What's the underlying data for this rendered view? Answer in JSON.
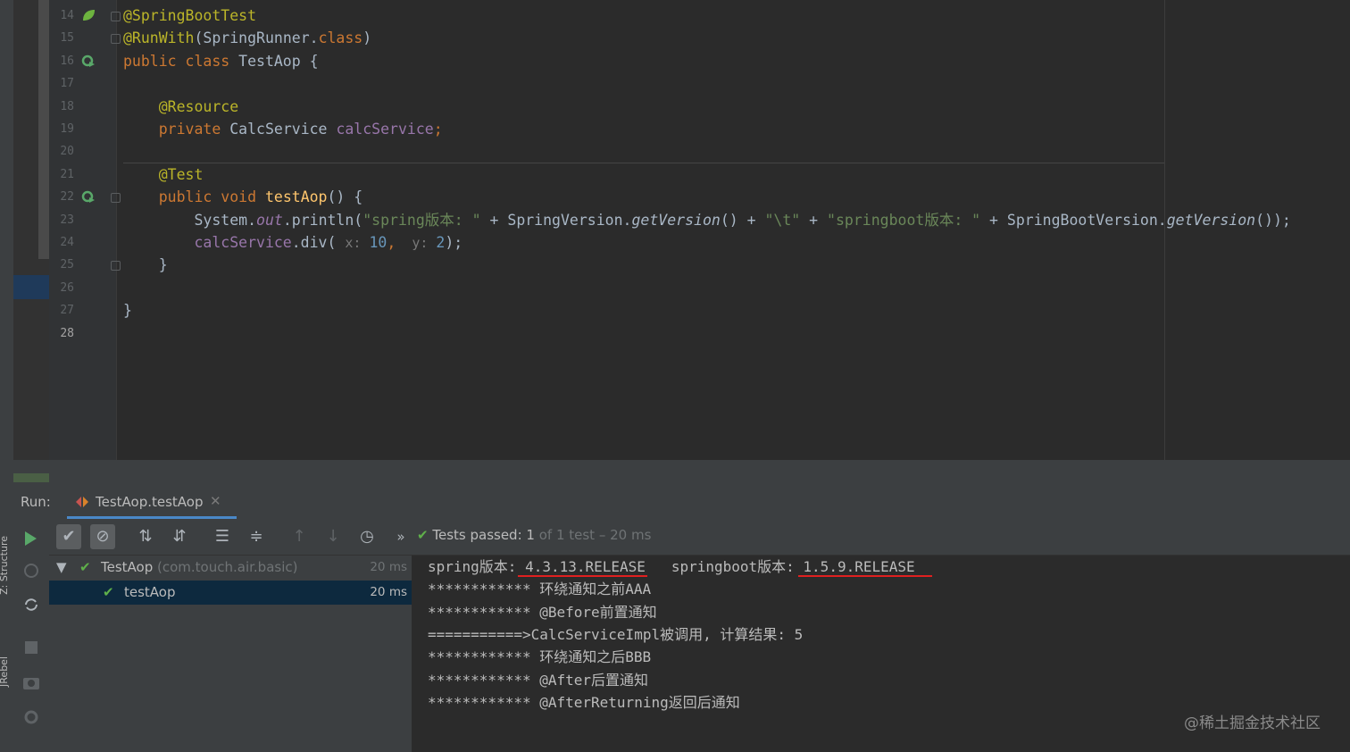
{
  "left_strip": {
    "tab_structure": "Z: Structure",
    "tab_rebel": "JRebel"
  },
  "editor": {
    "lines": [
      {
        "no": "14",
        "parts": [
          [
            "an",
            "@SpringBootTest"
          ]
        ]
      },
      {
        "no": "15",
        "parts": [
          [
            "an",
            "@RunWith"
          ],
          [
            "par",
            "(SpringRunner."
          ],
          [
            "kw",
            "class"
          ],
          [
            "par",
            ")"
          ]
        ]
      },
      {
        "no": "16",
        "parts": [
          [
            "kw",
            "public class "
          ],
          [
            "par",
            "TestAop {"
          ]
        ]
      },
      {
        "no": "17",
        "parts": []
      },
      {
        "no": "18",
        "parts": [
          [
            "an",
            "    @Resource"
          ]
        ]
      },
      {
        "no": "19",
        "parts": [
          [
            "kw",
            "    private "
          ],
          [
            "par",
            "CalcService "
          ],
          [
            "fld",
            "calcService"
          ],
          [
            "kw",
            ";"
          ]
        ]
      },
      {
        "no": "20",
        "parts": []
      },
      {
        "no": "21",
        "parts": [
          [
            "an",
            "    @Test"
          ]
        ]
      },
      {
        "no": "22",
        "parts": [
          [
            "kw",
            "    public void "
          ],
          [
            "fnc",
            "testAop"
          ],
          [
            "par",
            "() {"
          ]
        ]
      },
      {
        "no": "23",
        "parts": [
          [
            "par",
            "        System."
          ],
          [
            "fld it",
            "out"
          ],
          [
            "par",
            ".println("
          ],
          [
            "st",
            "\"spring版本: \""
          ],
          [
            "par",
            " + SpringVersion."
          ],
          [
            "it",
            "getVersion"
          ],
          [
            "par",
            "() + "
          ],
          [
            "st",
            "\"\\t\""
          ],
          [
            "par",
            " + "
          ],
          [
            "st",
            "\"springboot版本: \""
          ],
          [
            "par",
            " + SpringBootVersion."
          ],
          [
            "it",
            "getVersion"
          ],
          [
            "par",
            "());"
          ]
        ]
      },
      {
        "no": "24",
        "parts": [
          [
            "fld",
            "        calcService"
          ],
          [
            "par",
            ".div( "
          ],
          [
            "hint",
            "x: "
          ],
          [
            "num",
            "10"
          ],
          [
            "kw",
            ","
          ],
          [
            "hint",
            "  y: "
          ],
          [
            "num",
            "2"
          ],
          [
            "par",
            ");"
          ]
        ]
      },
      {
        "no": "25",
        "parts": [
          [
            "par",
            "    }"
          ]
        ]
      },
      {
        "no": "26",
        "parts": []
      },
      {
        "no": "27",
        "parts": [
          [
            "par",
            "}"
          ]
        ]
      },
      {
        "no": "28",
        "parts": []
      }
    ]
  },
  "run": {
    "label": "Run:",
    "tab_name": "TestAop.testAop",
    "tab_close": "✕",
    "status_prefix": "Tests passed: ",
    "status_count": "1",
    "status_rest": " of 1 test – 20 ms",
    "more": "»",
    "tree": [
      {
        "name": "TestAop",
        "pkg": " (com.touch.air.basic)",
        "time": "20 ms"
      },
      {
        "name": "testAop",
        "pkg": "",
        "time": "20 ms"
      }
    ],
    "console": [
      "spring版本: 4.3.13.RELEASE   springboot版本: 1.5.9.RELEASE",
      "************ 环绕通知之前AAA",
      "************ @Before前置通知",
      "===========>CalcServiceImpl被调用, 计算结果: 5",
      "************ 环绕通知之后BBB",
      "************ @After后置通知",
      "************ @AfterReturning返回后通知"
    ]
  },
  "watermark": "@稀土掘金技术社区",
  "colors": {
    "accent_blue": "#4a88c7",
    "pass_green": "#5fb04a",
    "underline_red": "#e02020"
  }
}
